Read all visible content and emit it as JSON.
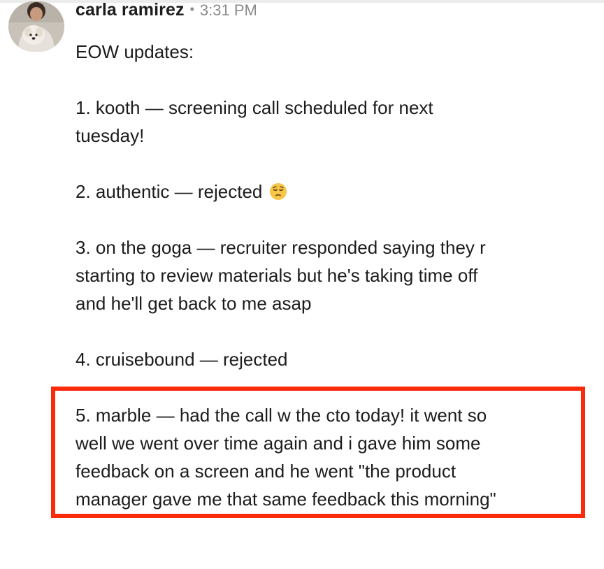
{
  "message": {
    "author": "carla ramirez",
    "separator": "•",
    "timestamp": "3:31 PM",
    "greeting": "EOW updates:",
    "items": [
      {
        "lines": [
          "1. kooth — screening call scheduled for next",
          "tuesday!"
        ]
      },
      {
        "lines": [
          "2. authentic — rejected"
        ],
        "emoji": "pensive-face-icon"
      },
      {
        "lines": [
          "3. on the goga — recruiter responded saying they r",
          "starting to review materials but he's taking time off",
          "and he'll get back to me asap"
        ]
      },
      {
        "lines": [
          "4. cruisebound — rejected"
        ]
      },
      {
        "lines": [
          "5. marble — had the call w the cto today! it went so",
          "well we went over time again and i gave him some",
          "feedback on a screen and he went \"the product",
          "manager gave me that same feedback this morning\""
        ]
      }
    ]
  },
  "colors": {
    "text": "#1d1c1d",
    "meta": "#8a8a8a",
    "highlight_border": "#fa2a0a",
    "emoji_face": "#f7c648"
  }
}
